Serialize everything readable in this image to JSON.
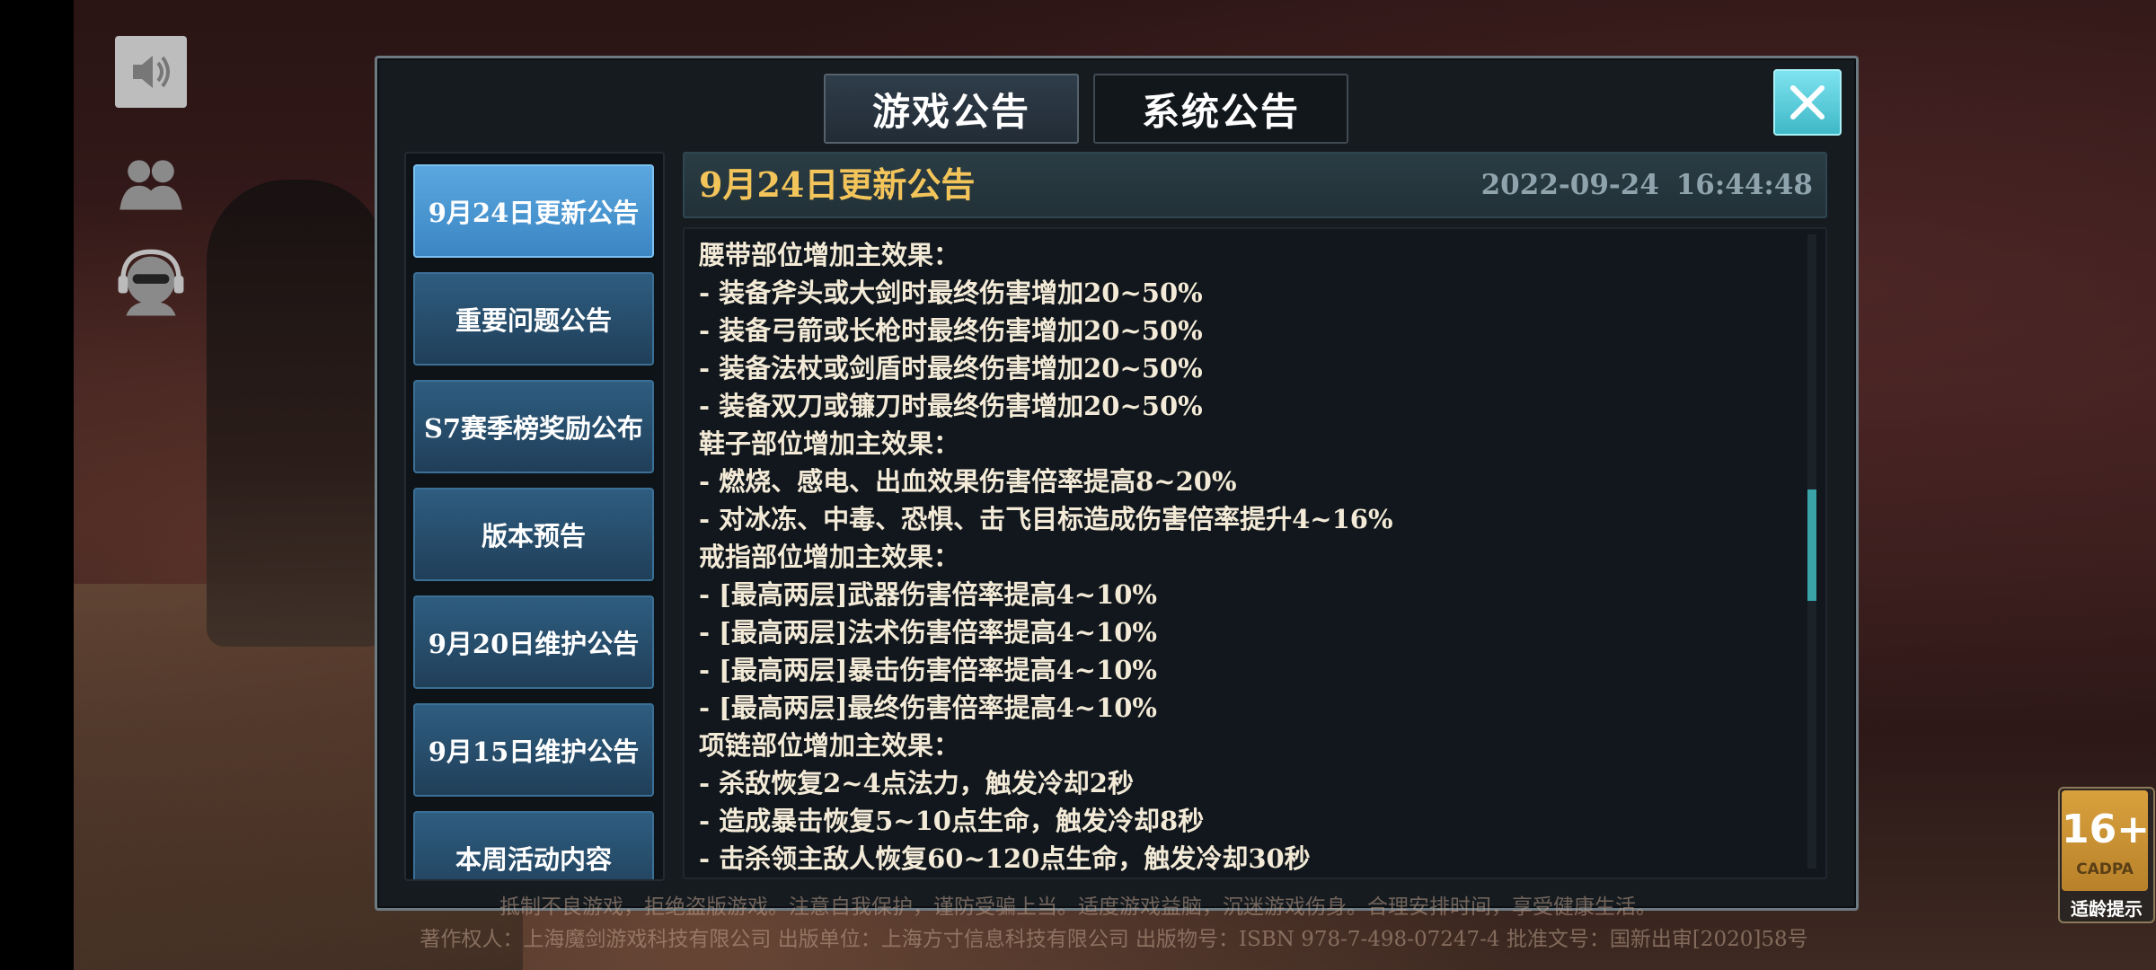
{
  "tabs": {
    "game_notice": "游戏公告",
    "system_notice": "系统公告"
  },
  "notice_list": [
    "9月24日更新公告",
    "重要问题公告",
    "S7赛季榜奖励公布",
    "版本预告",
    "9月20日维护公告",
    "9月15日维护公告",
    "本周活动内容"
  ],
  "selected_notice": {
    "title": "9月24日更新公告",
    "datetime": "2022-09-24 16:44:48"
  },
  "content_lines": [
    "腰带部位增加主效果：",
    "- 装备斧头或大剑时最终伤害增加20~50%",
    "- 装备弓箭或长枪时最终伤害增加20~50%",
    "- 装备法杖或剑盾时最终伤害增加20~50%",
    "- 装备双刀或镰刀时最终伤害增加20~50%",
    "鞋子部位增加主效果：",
    "- 燃烧、感电、出血效果伤害倍率提高8~20%",
    "- 对冰冻、中毒、恐惧、击飞目标造成伤害倍率提升4~16%",
    "戒指部位增加主效果：",
    "- [最高两层]武器伤害倍率提高4~10%",
    "- [最高两层]法术伤害倍率提高4~10%",
    "- [最高两层]暴击伤害倍率提高4~10%",
    "- [最高两层]最终伤害倍率提高4~10%",
    "项链部位增加主效果：",
    "- 杀敌恢复2~4点法力，触发冷却2秒",
    "- 造成暴击恢复5~10点生命，触发冷却8秒",
    "- 击杀领主敌人恢复60~120点生命，触发冷却30秒"
  ],
  "scroll": {
    "position_fraction": 0.42
  },
  "footer": {
    "line1": "抵制不良游戏，拒绝盗版游戏。注意自我保护，谨防受骗上当。适度游戏益脑，沉迷游戏伤身。合理安排时间，享受健康生活。",
    "line2": "著作权人：上海魔剑游戏科技有限公司 出版单位：上海方寸信息科技有限公司 出版物号：ISBN 978-7-498-07247-4 批准文号：国新出审[2020]58号"
  },
  "age_rating": {
    "age": "16+",
    "org": "CADPA",
    "caption": "适龄提示"
  },
  "colors": {
    "title_gold": "#f2c45a",
    "close_button": "#4fc6d4",
    "selected_item": "#4a96d2",
    "scroll_thumb": "#3aa3a8"
  },
  "icons": {
    "speaker": "speaker-icon",
    "friends": "friends-icon",
    "support": "headset-icon",
    "close": "close-icon"
  }
}
